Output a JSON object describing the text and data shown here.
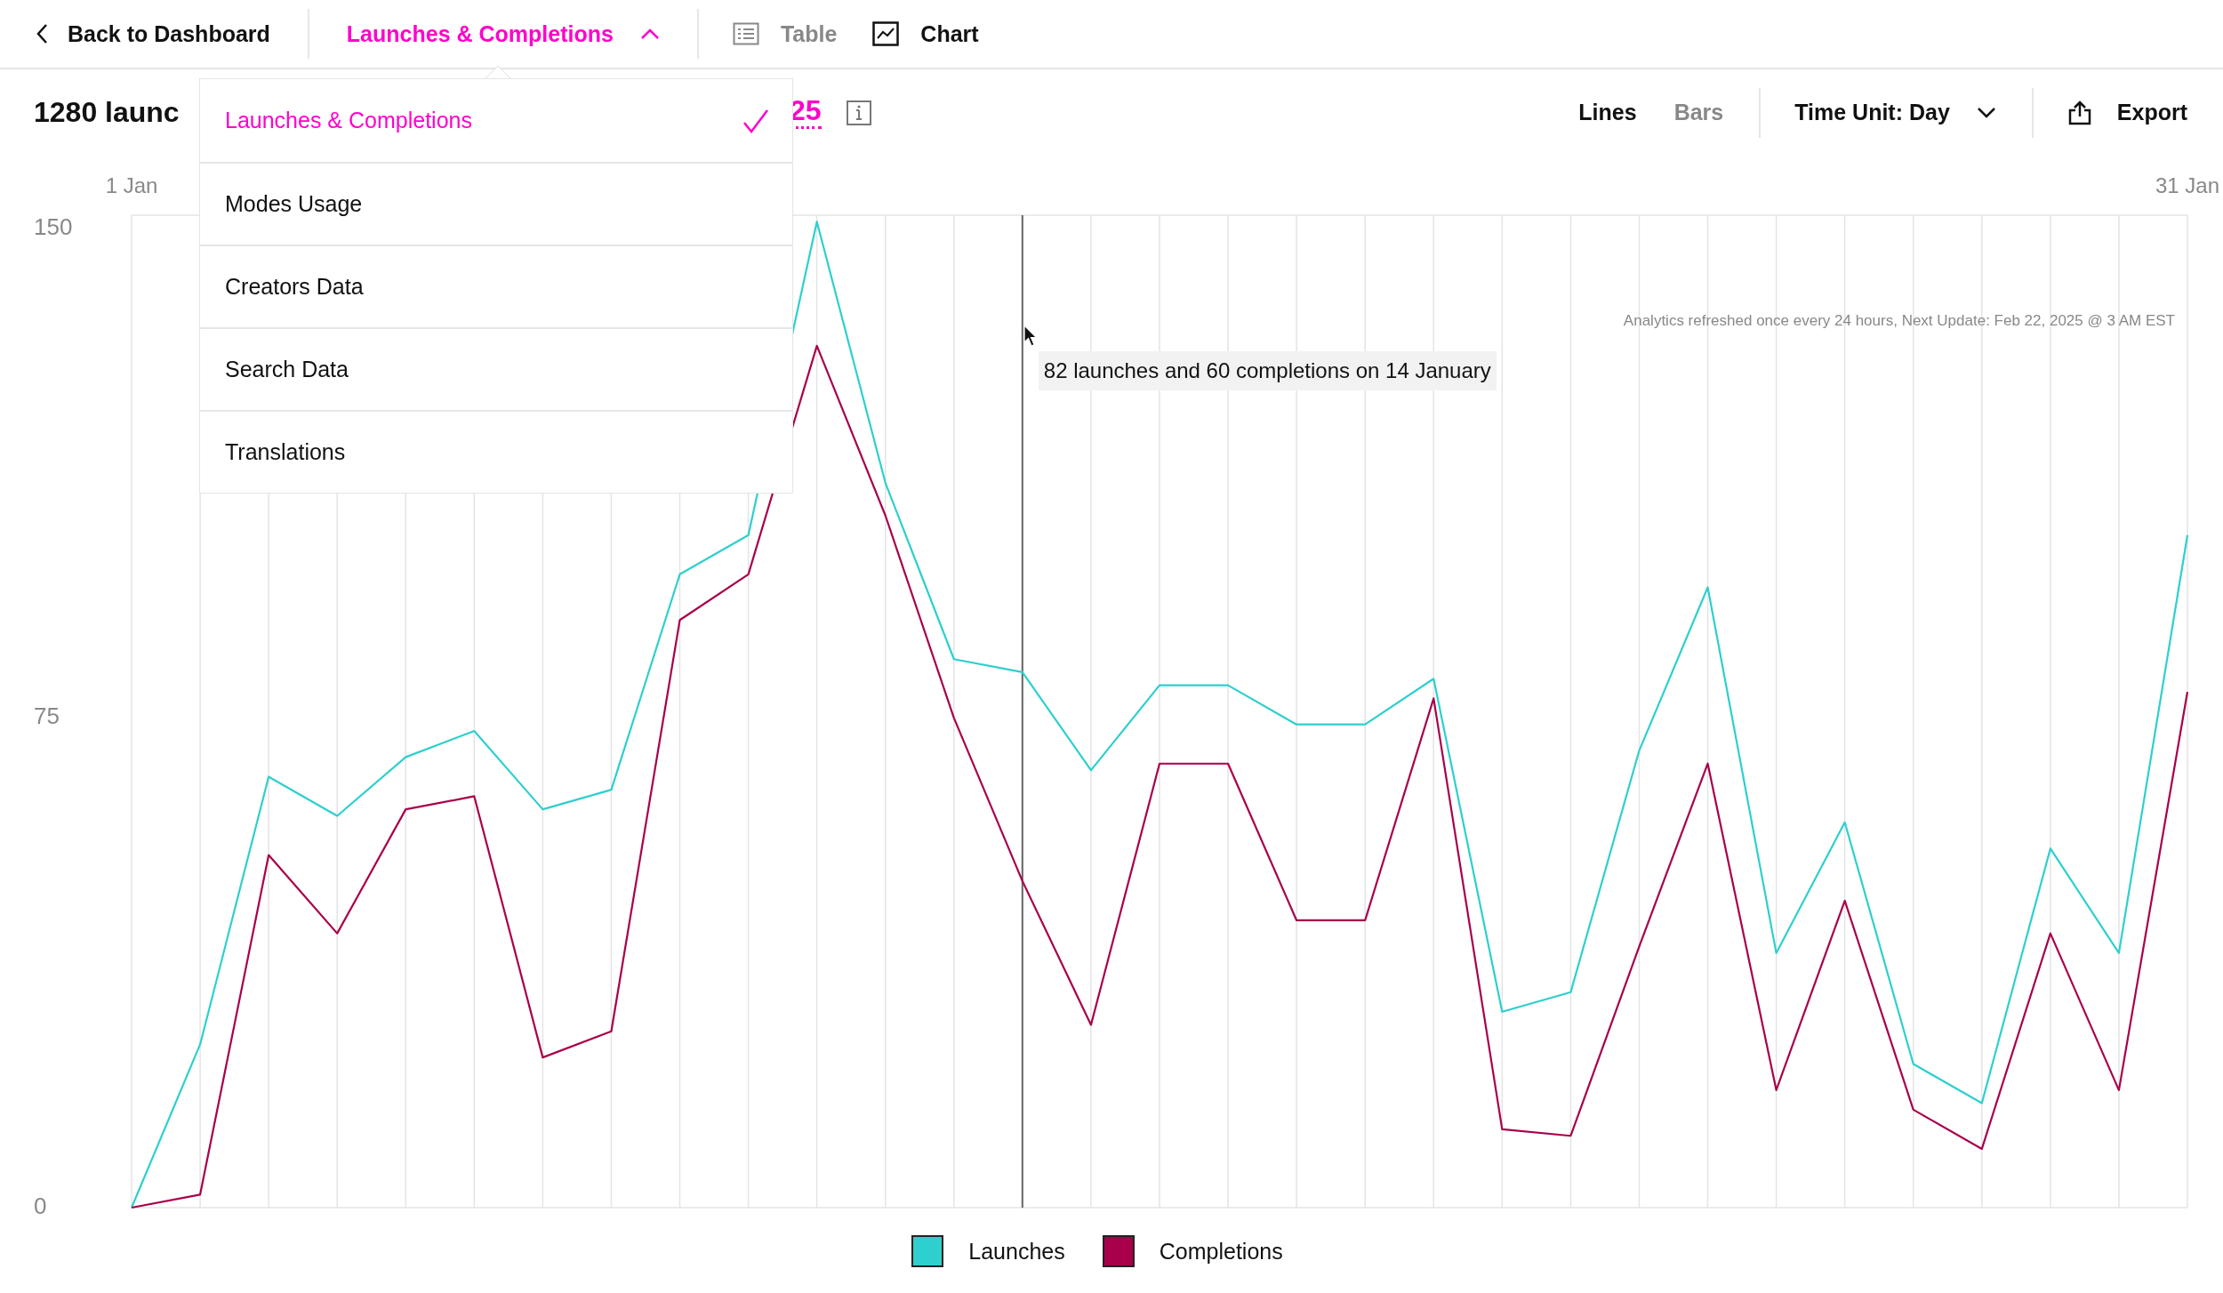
{
  "nav": {
    "back": "Back to Dashboard",
    "report": {
      "label": "Launches & Completions",
      "expanded": true
    },
    "views": [
      {
        "label": "Table",
        "kind": "table",
        "selected": false
      },
      {
        "label": "Chart",
        "kind": "chart",
        "selected": true
      }
    ]
  },
  "dropdown": {
    "items": [
      {
        "label": "Launches & Completions",
        "selected": true
      },
      {
        "label": "Modes Usage",
        "selected": false
      },
      {
        "label": "Creators Data",
        "selected": false
      },
      {
        "label": "Search Data",
        "selected": false
      },
      {
        "label": "Translations",
        "selected": false
      }
    ]
  },
  "header": {
    "title": "1280 launc",
    "date_fragment": "25",
    "chart_types": [
      {
        "label": "Lines",
        "selected": true
      },
      {
        "label": "Bars",
        "selected": false
      }
    ],
    "time_unit": "Time Unit: Day",
    "export": "Export"
  },
  "chart": {
    "note": "Analytics refreshed once every 24 hours, Next Update: Feb 22, 2025 @ 3 AM EST",
    "cursor": {
      "level": 0.4333
    },
    "chart_data": {
      "type": "line",
      "categories": [
        "1 Jan",
        null,
        null,
        null,
        null,
        null,
        null,
        null,
        null,
        null,
        null,
        null,
        null,
        null,
        null,
        null,
        null,
        null,
        null,
        null,
        null,
        null,
        null,
        null,
        null,
        null,
        null,
        null,
        null,
        null,
        "31 Jan"
      ],
      "ylim": [
        0,
        152
      ],
      "yticks": [
        0,
        75,
        150
      ],
      "series": [
        {
          "name": "Launches",
          "color": "#2ecfcf",
          "values": [
            0,
            25,
            66,
            60,
            69,
            73,
            61,
            64,
            97,
            103,
            151,
            111,
            84,
            82,
            67,
            80,
            80,
            74,
            74,
            81,
            30,
            33,
            70,
            95,
            39,
            59,
            22,
            16,
            55,
            39,
            103
          ]
        },
        {
          "name": "Completions",
          "color": "#a8004a",
          "values": [
            0,
            2,
            54,
            42,
            61,
            63,
            23,
            27,
            90,
            97,
            132,
            106,
            75,
            50,
            28,
            68,
            68,
            44,
            44,
            78,
            12,
            11,
            40,
            68,
            18,
            47,
            15,
            9,
            42,
            18,
            79
          ]
        }
      ],
      "grid": true,
      "annotations": [
        "82 launches and 60 completions on 14 January"
      ]
    }
  }
}
